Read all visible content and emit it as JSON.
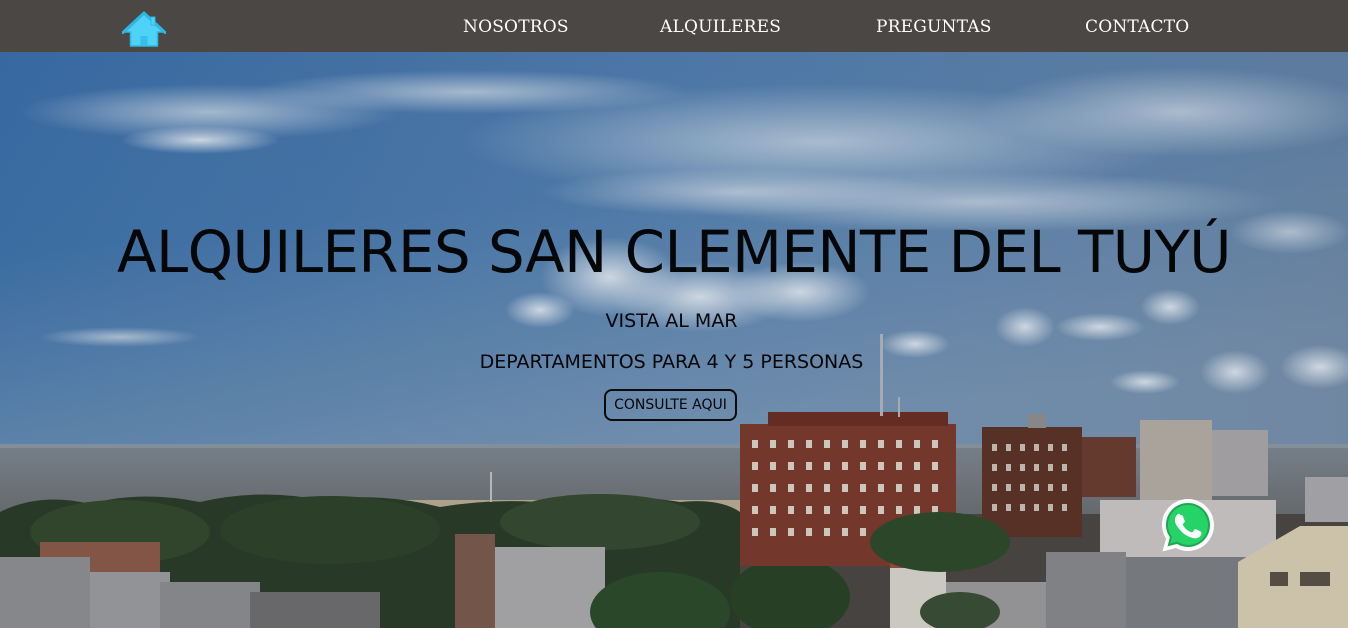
{
  "colors": {
    "navbar_bg": "#4a4744",
    "nav_text": "#ffffff",
    "home_icon": "#4fd2f8",
    "hero_text": "#050608",
    "whatsapp_green": "#25d366"
  },
  "navbar": {
    "home_icon": "house-icon",
    "items": [
      {
        "label": "NOSOTROS"
      },
      {
        "label": "ALQUILERES"
      },
      {
        "label": "PREGUNTAS"
      },
      {
        "label": "CONTACTO"
      }
    ]
  },
  "hero": {
    "title": "ALQUILERES SAN CLEMENTE DEL TUYÚ",
    "subtitle": "VISTA AL MAR",
    "description": "DEPARTAMENTOS PARA 4 Y 5 PERSONAS",
    "cta_label": "CONSULTE AQUI"
  },
  "whatsapp": {
    "icon": "whatsapp-icon"
  }
}
